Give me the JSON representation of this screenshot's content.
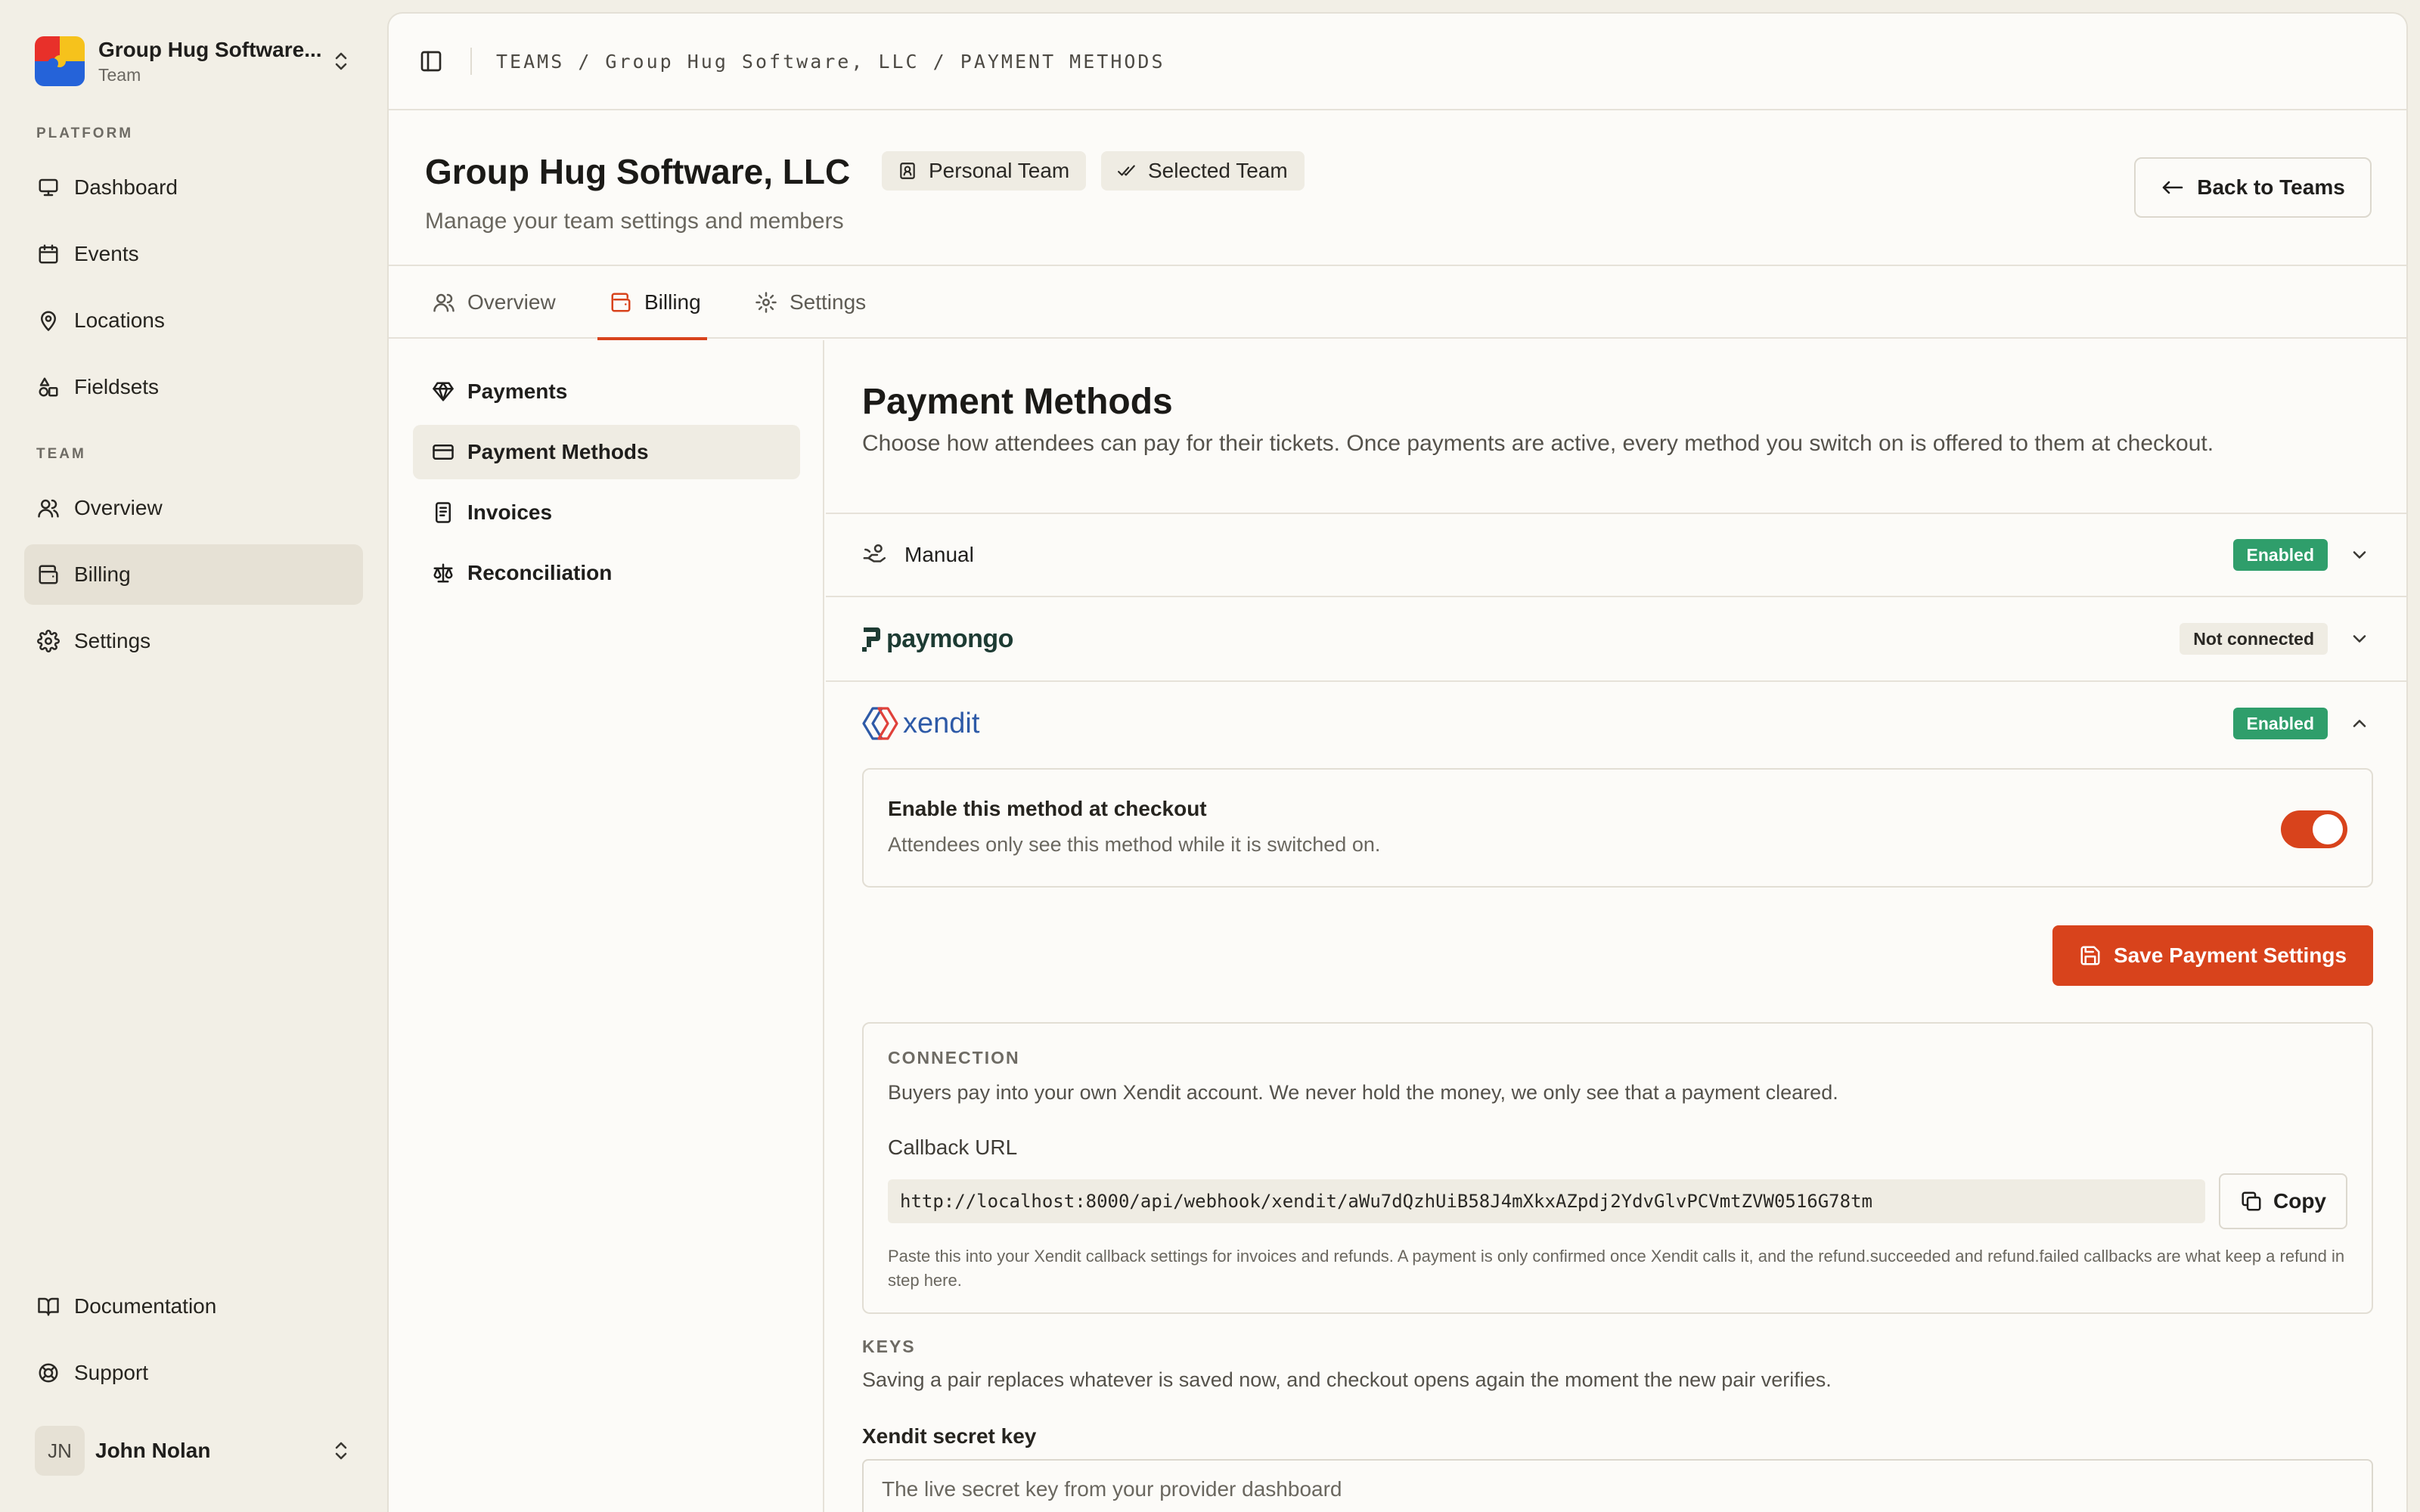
{
  "team": {
    "name": "Group Hug Software...",
    "role": "Team"
  },
  "sidebar": {
    "platform_label": "PLATFORM",
    "platform_items": [
      {
        "label": "Dashboard",
        "icon": "monitor-icon"
      },
      {
        "label": "Events",
        "icon": "calendar-icon"
      },
      {
        "label": "Locations",
        "icon": "map-pin-icon"
      },
      {
        "label": "Fieldsets",
        "icon": "shapes-icon"
      }
    ],
    "team_label": "TEAM",
    "team_items": [
      {
        "label": "Overview",
        "icon": "users-icon"
      },
      {
        "label": "Billing",
        "icon": "wallet-icon",
        "active": true
      },
      {
        "label": "Settings",
        "icon": "gear-icon"
      }
    ],
    "footer_items": [
      {
        "label": "Documentation",
        "icon": "book-icon"
      },
      {
        "label": "Support",
        "icon": "lifebuoy-icon"
      }
    ]
  },
  "user": {
    "initials": "JN",
    "name": "John Nolan"
  },
  "breadcrumb": {
    "part1": "TEAMS",
    "sep": " / ",
    "part2": "Group Hug Software, LLC",
    "part3": "PAYMENT METHODS"
  },
  "header": {
    "title": "Group Hug Software, LLC",
    "chip_personal": "Personal Team",
    "chip_selected": "Selected Team",
    "subtitle": "Manage your team settings and members",
    "back_label": "Back to Teams"
  },
  "tabs": [
    {
      "label": "Overview",
      "icon": "users-icon"
    },
    {
      "label": "Billing",
      "icon": "wallet-icon",
      "active": true
    },
    {
      "label": "Settings",
      "icon": "gear-icon"
    }
  ],
  "subnav": [
    {
      "label": "Payments",
      "icon": "gem-icon"
    },
    {
      "label": "Payment Methods",
      "icon": "credit-card-icon",
      "active": true
    },
    {
      "label": "Invoices",
      "icon": "receipt-icon"
    },
    {
      "label": "Reconciliation",
      "icon": "scale-icon"
    }
  ],
  "content": {
    "title": "Payment Methods",
    "description": "Choose how attendees can pay for their tickets. Once payments are active, every method you switch on is offered to them at checkout."
  },
  "methods": {
    "manual": {
      "name": "Manual",
      "status": "Enabled"
    },
    "paymongo": {
      "name": "paymongo",
      "status": "Not connected"
    },
    "xendit": {
      "name": "xendit",
      "status": "Enabled"
    }
  },
  "xendit_panel": {
    "toggle_title": "Enable this method at checkout",
    "toggle_sub": "Attendees only see this method while it is switched on.",
    "enabled": true,
    "save_label": "Save Payment Settings",
    "connection_label": "CONNECTION",
    "connection_desc": "Buyers pay into your own Xendit account. We never hold the money, we only see that a payment cleared.",
    "callback_label": "Callback URL",
    "callback_url": "http://localhost:8000/api/webhook/xendit/aWu7dQzhUiB58J4mXkxAZpdj2YdvGlvPCVmtZVW0516G78tm",
    "copy_label": "Copy",
    "callback_note": "Paste this into your Xendit callback settings for invoices and refunds. A payment is only confirmed once Xendit calls it, and the refund.succeeded and refund.failed callbacks are what keep a refund in step here.",
    "keys_label": "KEYS",
    "keys_desc": "Saving a pair replaces whatever is saved now, and checkout opens again the moment the new pair verifies.",
    "secret_label": "Xendit secret key",
    "secret_placeholder": "The live secret key from your provider dashboard"
  },
  "colors": {
    "accent": "#d8431c",
    "enabled": "#2f9e6b",
    "paymongo": "#1d3b33",
    "xendit": "#2e5aa7"
  }
}
